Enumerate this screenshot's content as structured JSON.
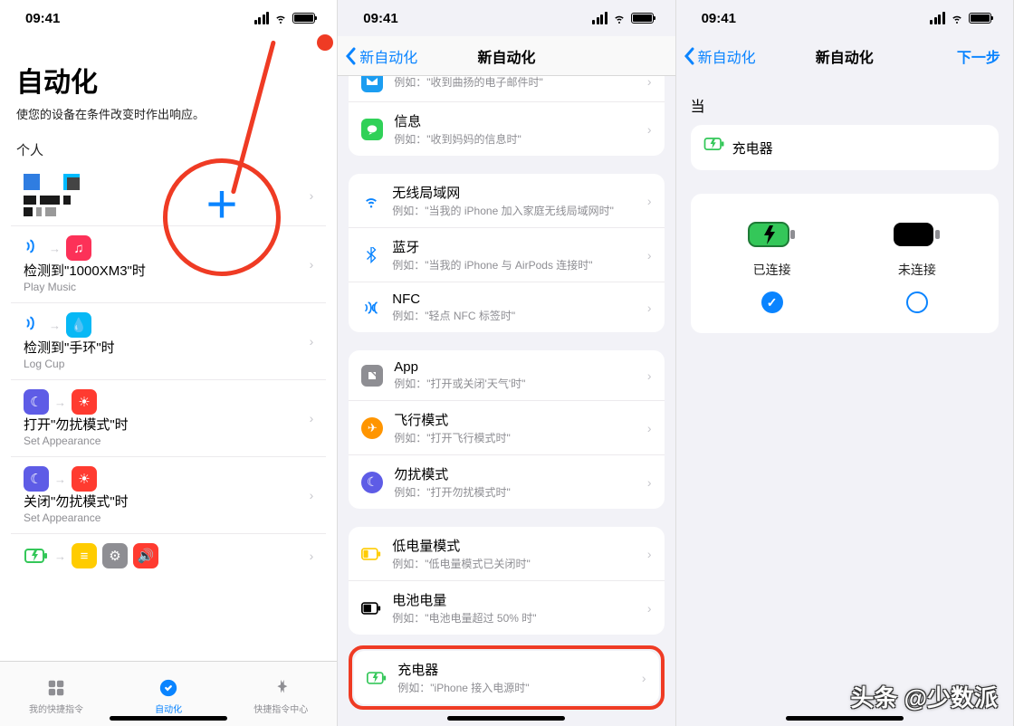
{
  "status": {
    "time": "09:41"
  },
  "phone1": {
    "title": "自动化",
    "subtitle": "使您的设备在条件改变时作出响应。",
    "sectionLabel": "个人",
    "items": [
      {
        "title": "检测到\"1000XM3\"时",
        "sub": "Play Music"
      },
      {
        "title": "检测到\"手环\"时",
        "sub": "Log Cup"
      },
      {
        "title": "打开\"勿扰模式\"时",
        "sub": "Set Appearance"
      },
      {
        "title": "关闭\"勿扰模式\"时",
        "sub": "Set Appearance"
      }
    ],
    "tabs": {
      "shortcuts": "我的快捷指令",
      "automation": "自动化",
      "gallery": "快捷指令中心"
    }
  },
  "phone2": {
    "back": "新自动化",
    "title": "新自动化",
    "groups": [
      [
        {
          "icon": "mail",
          "title": "",
          "sub": "例如：\"收到曲扬的电子邮件时\""
        },
        {
          "icon": "message",
          "title": "信息",
          "sub": "例如：\"收到妈妈的信息时\""
        }
      ],
      [
        {
          "icon": "wifi",
          "title": "无线局域网",
          "sub": "例如：\"当我的 iPhone 加入家庭无线局域网时\""
        },
        {
          "icon": "bluetooth",
          "title": "蓝牙",
          "sub": "例如：\"当我的 iPhone 与 AirPods 连接时\""
        },
        {
          "icon": "nfc",
          "title": "NFC",
          "sub": "例如：\"轻点 NFC 标签时\""
        }
      ],
      [
        {
          "icon": "app",
          "title": "App",
          "sub": "例如：\"打开或关闭'天气'时\""
        },
        {
          "icon": "airplane",
          "title": "飞行模式",
          "sub": "例如：\"打开飞行模式时\""
        },
        {
          "icon": "dnd",
          "title": "勿扰模式",
          "sub": "例如：\"打开勿扰模式时\""
        }
      ],
      [
        {
          "icon": "lowpower",
          "title": "低电量模式",
          "sub": "例如：\"低电量模式已关闭时\""
        },
        {
          "icon": "batterylevel",
          "title": "电池电量",
          "sub": "例如：\"电池电量超过 50% 时\""
        }
      ]
    ],
    "highlight": {
      "icon": "charger",
      "title": "充电器",
      "sub": "例如：\"iPhone 接入电源时\""
    }
  },
  "phone3": {
    "back": "新自动化",
    "title": "新自动化",
    "next": "下一步",
    "when": "当",
    "card": "充电器",
    "opt1": "已连接",
    "opt2": "未连接"
  },
  "watermark": "头条 @少数派"
}
